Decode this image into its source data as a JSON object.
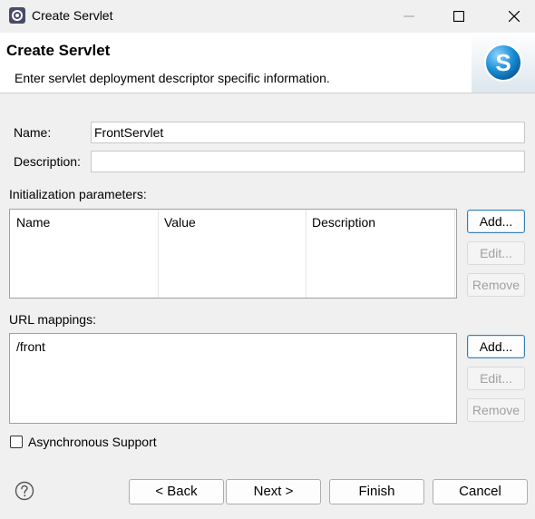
{
  "window": {
    "title": "Create Servlet"
  },
  "header": {
    "title": "Create Servlet",
    "description": "Enter servlet deployment descriptor specific information.",
    "logo_icon": "servlet-logo-icon"
  },
  "form": {
    "name_label": "Name:",
    "name_value": "FrontServlet",
    "description_label": "Description:",
    "description_value": ""
  },
  "init_params": {
    "label": "Initialization parameters:",
    "columns": [
      "Name",
      "Value",
      "Description"
    ],
    "rows": [],
    "add_label": "Add...",
    "edit_label": "Edit...",
    "remove_label": "Remove"
  },
  "url_mappings": {
    "label": "URL mappings:",
    "items": [
      "/front"
    ],
    "add_label": "Add...",
    "edit_label": "Edit...",
    "remove_label": "Remove"
  },
  "async": {
    "label": "Asynchronous Support",
    "checked": false
  },
  "footer": {
    "back_label": "< Back",
    "next_label": "Next >",
    "finish_label": "Finish",
    "cancel_label": "Cancel"
  },
  "colors": {
    "accent": "#3c7fb1",
    "logo_blue": "#1a8fd6"
  }
}
